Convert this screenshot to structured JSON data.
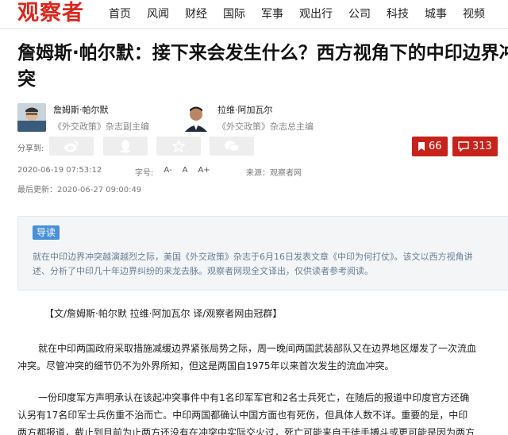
{
  "site": {
    "logo": "观察者"
  },
  "nav": [
    "首页",
    "风闻",
    "财经",
    "国际",
    "军事",
    "观出行",
    "公司",
    "科技",
    "城事",
    "视频"
  ],
  "article": {
    "title_line1": "詹姆斯·帕尔默：接下来会发生什么？西方视角下的中印边界冲",
    "title_line2": "突"
  },
  "authors": [
    {
      "name": "詹姆斯·帕尔默",
      "role": "《外交政策》杂志副主编"
    },
    {
      "name": "拉维·阿加瓦尔",
      "role": "《外交政策》杂志总主编"
    }
  ],
  "share": {
    "label": "分享到:",
    "buttons": [
      "weibo-icon",
      "qq-icon",
      "qzone-star-icon",
      "wechat-icon"
    ]
  },
  "counts": {
    "bookmark": "66",
    "comments": "313"
  },
  "meta": {
    "publish_time": "2020-06-19 07:53:12",
    "font_label": "字号:",
    "font_sizes": [
      "A-",
      "A",
      "A+"
    ],
    "source": "来源：观察者网",
    "updated": "最后更新：2020-06-27 09:00:49"
  },
  "intro": {
    "tag": "导读",
    "text_line1": "就在中印边界冲突越演越烈之际，美国《外交政策》杂志于6月16日发表文章《中印为何打仗》。该文以西方视角讲",
    "text_line2": "述、分析了中印几十年边界纠纷的来龙去脉。观察者网现全文译出，仅供读者参考阅读。"
  },
  "body": {
    "byline": "【文/詹姆斯·帕尔默 拉维·阿加瓦尔 译/观察者网由冠群】",
    "p1_line1": "就在中印两国政府采取措施减缓边界紧张局势之际，周一晚间两国武装部队又在边界地区爆发了一次流血",
    "p1_line2": "冲突。尽管冲突的细节仍不为外界所知，但这是两国自1975年以来首次发生的流血冲突。",
    "p2_line1": "一份印度军方声明承认在该起冲突事件中有1名印军军官和2名士兵死亡，在随后的报道中印度官方还确",
    "p2_line2": "认另有17名印军士兵伤重不治而亡。中印两国都确认中国方面也有死伤，但具体人数不详。重要的是，中印",
    "p2_line3": "两方都报道，截止到目前为止两方还没有在冲突中实际交火过，死亡可能来自于徒手搏斗或更可能是因为两方"
  }
}
